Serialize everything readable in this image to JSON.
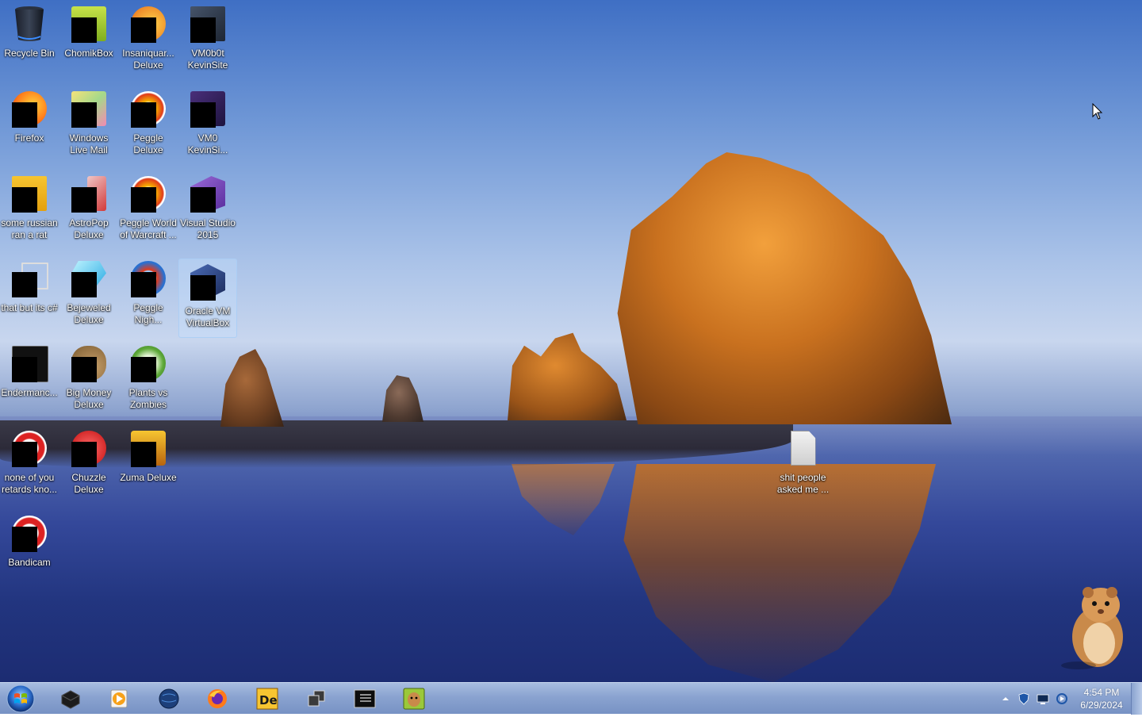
{
  "desktop": {
    "icons": [
      {
        "label": "Recycle Bin"
      },
      {
        "label": "ChomikBox"
      },
      {
        "label": "Insaniquar... Deluxe"
      },
      {
        "label": "VM0b0t KevinSite"
      },
      {
        "label": "Firefox"
      },
      {
        "label": "Windows Live Mail"
      },
      {
        "label": "Peggle Deluxe"
      },
      {
        "label": "VM0 KevinSi..."
      },
      {
        "label": "some russian ran a rat"
      },
      {
        "label": "AstroPop Deluxe"
      },
      {
        "label": "Peggle World of Warcraft ..."
      },
      {
        "label": "Visual Studio 2015"
      },
      {
        "label": "that but its c#"
      },
      {
        "label": "Bejeweled Deluxe"
      },
      {
        "label": "Peggle Nigh..."
      },
      {
        "label": "Oracle VM VirtualBox"
      },
      {
        "label": "Endermanc..."
      },
      {
        "label": "Big Money Deluxe"
      },
      {
        "label": "Plants vs Zombies"
      },
      {
        "label": "none of you retards kno..."
      },
      {
        "label": "Chuzzle Deluxe"
      },
      {
        "label": "Zuma Deluxe"
      },
      {
        "label": "Bandicam"
      }
    ],
    "file_icon": {
      "label": "shit people asked me ..."
    },
    "selected_icon": "Oracle VM VirtualBox"
  },
  "taskbar": {
    "pinned": [
      {
        "icon": "virtualbox-dark-icon"
      },
      {
        "icon": "media-player-icon"
      },
      {
        "icon": "globe-icon"
      },
      {
        "icon": "firefox-icon"
      },
      {
        "icon": "de-app-icon"
      },
      {
        "icon": "windows-stack-icon"
      },
      {
        "icon": "console-icon"
      },
      {
        "icon": "chomikbox-icon"
      }
    ],
    "tray": {
      "icons": [
        "show-hidden-icons-arrow",
        "security-shield-icon",
        "network-monitor-icon",
        "volume-sync-icon"
      ]
    },
    "clock": {
      "time": "4:54 PM",
      "date": "6/29/2024"
    }
  },
  "colors": {
    "taskbar": "#8aa3d0",
    "selection": "#c8e1ff"
  }
}
